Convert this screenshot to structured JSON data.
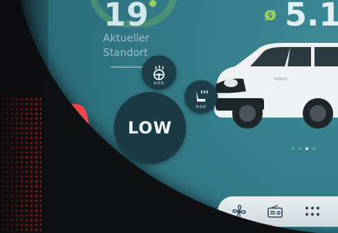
{
  "weather": {
    "temperature": "19",
    "location_line1": "Aktueller",
    "location_line2": "Standort"
  },
  "consumption": {
    "symbol": "ø",
    "value": "5.1"
  },
  "heating": {
    "steering_wheel_label": "ooo",
    "seat_label": "ooo",
    "level": "LOW"
  },
  "slider": {
    "plus": "+",
    "minus": "-"
  },
  "colors": {
    "screen": "#2f7482",
    "button_dark": "#1b3a44",
    "slider_red": "#f0464a",
    "slider_teal": "#6fd6d3",
    "accent_green": "#9ccf5a",
    "warn_red": "#e0262b"
  },
  "dock": {
    "items": [
      "fan-icon",
      "radio-icon",
      "apps-grid-icon"
    ]
  }
}
